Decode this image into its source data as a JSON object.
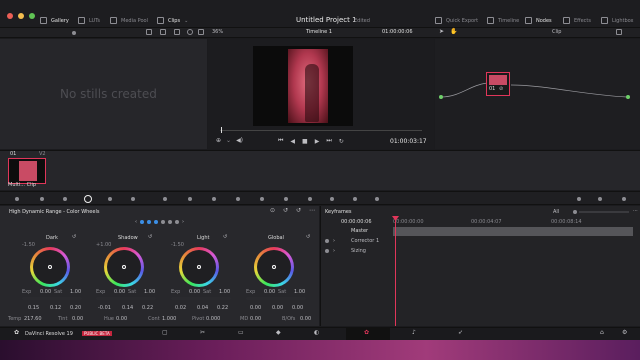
{
  "top": {
    "gallery": "Gallery",
    "luts": "LUTs",
    "media_pool": "Media Pool",
    "clips": "Clips",
    "project": "Untitled Project 1",
    "edited": "Edited",
    "quick_export": "Quick Export",
    "timeline": "Timeline",
    "nodes": "Nodes",
    "effects": "Effects",
    "lightbox": "Lightbox"
  },
  "viewer_bar": {
    "zoom": "36%",
    "timeline": "Timeline 1",
    "timecode": "01:00:00:06",
    "clip": "Clip"
  },
  "gallery": {
    "empty": "No stills created"
  },
  "viewer": {
    "timecode": "01:00:03:17"
  },
  "node": {
    "label": "01"
  },
  "thumb": {
    "index": "01",
    "track": "V2",
    "label": "Multi... Clip"
  },
  "wheels": {
    "title": "High Dynamic Range - Color Wheels",
    "items": [
      {
        "name": "Dark",
        "val": "-1.50",
        "exp": "0.00",
        "sat": "1.00",
        "a": "0.15",
        "b": "0.12",
        "c": "0.20"
      },
      {
        "name": "Shadow",
        "val": "+1.00",
        "exp": "0.00",
        "sat": "1.00",
        "a": "-0.01",
        "b": "0.14",
        "c": "0.22"
      },
      {
        "name": "Light",
        "val": "-1.50",
        "exp": "0.00",
        "sat": "1.00",
        "a": "0.02",
        "b": "0.04",
        "c": "0.22"
      },
      {
        "name": "Global",
        "val": "",
        "exp": "0.00",
        "sat": "1.00",
        "a": "0.00",
        "b": "0.00",
        "c": "0.00"
      }
    ],
    "labels": {
      "exp": "Exp",
      "sat": "Sat"
    },
    "bottom": {
      "temp_l": "Temp",
      "temp": "217.60",
      "tint_l": "Tint",
      "tint": "0.00",
      "hue_l": "Hue",
      "hue": "0.00",
      "cont_l": "Cont",
      "cont": "1.000",
      "pivot_l": "Pivot",
      "pivot": "0.000",
      "md_l": "MD",
      "md": "0.00",
      "bofs_l": "B/Ofs",
      "bofs": "0.00"
    }
  },
  "keyframes": {
    "title": "Keyframes",
    "filter": "All",
    "tc": "00:00:00:06",
    "ticks": [
      "00:00:00:00",
      "00:00:04:07",
      "00:00:08:14"
    ],
    "rows": [
      "Master",
      "Corrector 1",
      "Sizing"
    ]
  },
  "status": {
    "app": "DaVinci Resolve 19",
    "beta": "PUBLIC BETA"
  },
  "colors": {
    "accent": "#e0365a",
    "bg": "#1b1b1e",
    "panel": "#242427"
  }
}
